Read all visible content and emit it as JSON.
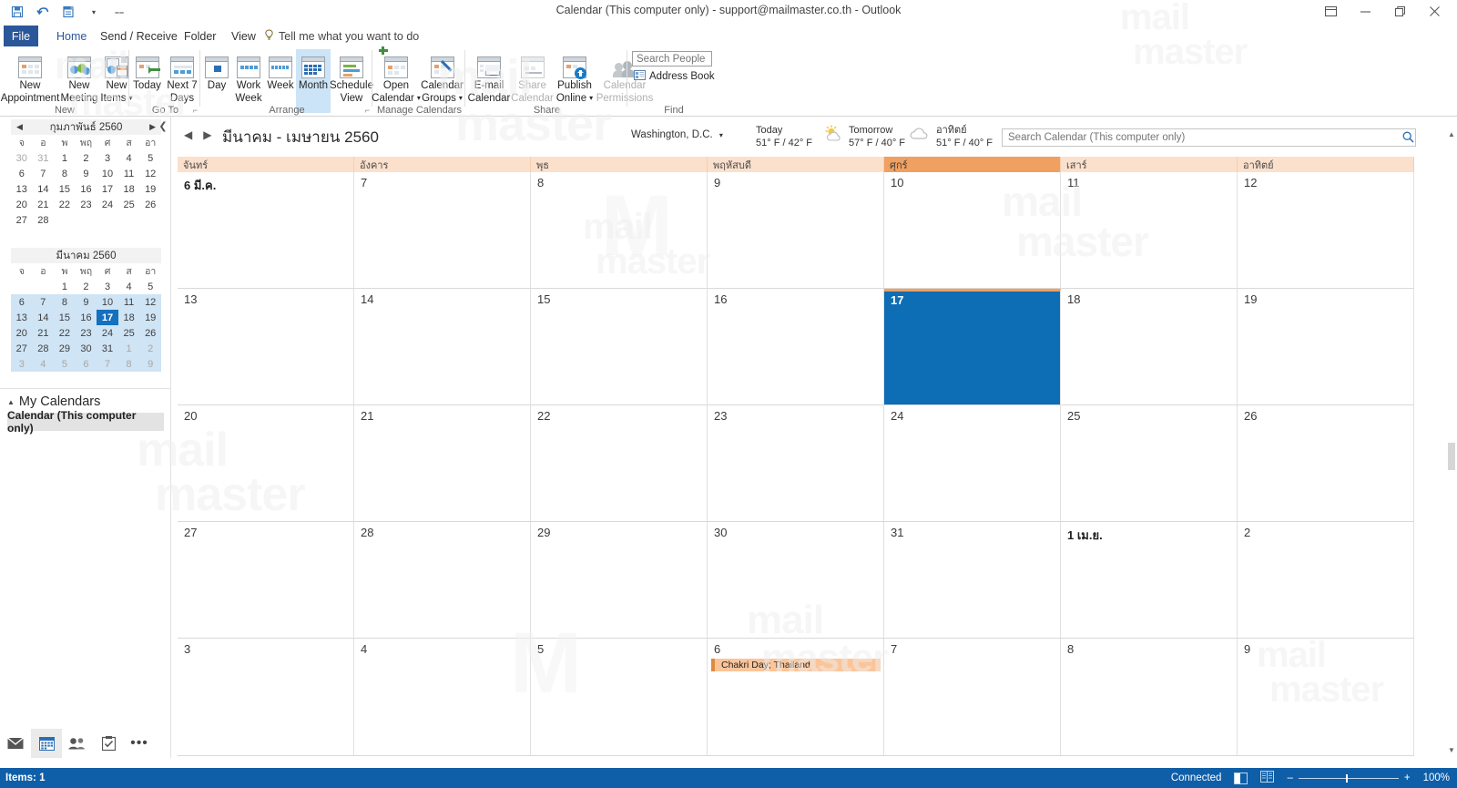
{
  "window": {
    "title": "Calendar (This computer only) - support@mailmaster.co.th  -  Outlook",
    "quick_access": [
      "save-icon",
      "undo-icon",
      "print-icon",
      "dropdown-icon",
      "customize-icon"
    ],
    "controls": [
      "ribbon-display-options-icon",
      "minimize-icon",
      "restore-icon",
      "close-icon"
    ]
  },
  "tabs": [
    {
      "label": "File",
      "name": "tab-file"
    },
    {
      "label": "Home",
      "name": "tab-home"
    },
    {
      "label": "Send / Receive",
      "name": "tab-send-receive"
    },
    {
      "label": "Folder",
      "name": "tab-folder"
    },
    {
      "label": "View",
      "name": "tab-view"
    }
  ],
  "tellme": "Tell me what you want to do",
  "ribbon": {
    "groups": [
      {
        "title": "New"
      },
      {
        "title": "Go To"
      },
      {
        "title": "Arrange"
      },
      {
        "title": "Manage Calendars"
      },
      {
        "title": "Share"
      },
      {
        "title": "Find"
      }
    ],
    "new_appointment": "New\nAppointment",
    "new_appointment_l1": "New",
    "new_appointment_l2": "Appointment",
    "new_meeting_l1": "New",
    "new_meeting_l2": "Meeting",
    "new_items_l1": "New",
    "new_items_l2": "Items",
    "today": "Today",
    "next7_l1": "Next 7",
    "next7_l2": "Days",
    "day": "Day",
    "work_week_l1": "Work",
    "work_week_l2": "Week",
    "week": "Week",
    "month": "Month",
    "schedule_l1": "Schedule",
    "schedule_l2": "View",
    "open_calendar_l1": "Open",
    "open_calendar_l2": "Calendar",
    "calendar_groups_l1": "Calendar",
    "calendar_groups_l2": "Groups",
    "email_calendar_l1": "E-mail",
    "email_calendar_l2": "Calendar",
    "share_calendar_l1": "Share",
    "share_calendar_l2": "Calendar",
    "publish_online_l1": "Publish",
    "publish_online_l2": "Online",
    "calendar_permissions_l1": "Calendar",
    "calendar_permissions_l2": "Permissions",
    "search_people_placeholder": "Search People",
    "address_book": "Address Book"
  },
  "sidebar": {
    "minicals": [
      {
        "title": "กุมภาพันธ์ 2560",
        "dow": [
          "จ",
          "อ",
          "พ",
          "พฤ",
          "ศ",
          "ส",
          "อา"
        ],
        "weeks": [
          [
            {
              "d": "30",
              "s": "dim"
            },
            {
              "d": "31",
              "s": "dim"
            },
            {
              "d": "1",
              "s": ""
            },
            {
              "d": "2",
              "s": ""
            },
            {
              "d": "3",
              "s": ""
            },
            {
              "d": "4",
              "s": ""
            },
            {
              "d": "5",
              "s": ""
            }
          ],
          [
            {
              "d": "6",
              "s": ""
            },
            {
              "d": "7",
              "s": ""
            },
            {
              "d": "8",
              "s": ""
            },
            {
              "d": "9",
              "s": ""
            },
            {
              "d": "10",
              "s": ""
            },
            {
              "d": "11",
              "s": ""
            },
            {
              "d": "12",
              "s": ""
            }
          ],
          [
            {
              "d": "13",
              "s": ""
            },
            {
              "d": "14",
              "s": ""
            },
            {
              "d": "15",
              "s": ""
            },
            {
              "d": "16",
              "s": ""
            },
            {
              "d": "17",
              "s": ""
            },
            {
              "d": "18",
              "s": ""
            },
            {
              "d": "19",
              "s": ""
            }
          ],
          [
            {
              "d": "20",
              "s": ""
            },
            {
              "d": "21",
              "s": ""
            },
            {
              "d": "22",
              "s": ""
            },
            {
              "d": "23",
              "s": ""
            },
            {
              "d": "24",
              "s": ""
            },
            {
              "d": "25",
              "s": ""
            },
            {
              "d": "26",
              "s": ""
            }
          ],
          [
            {
              "d": "27",
              "s": ""
            },
            {
              "d": "28",
              "s": ""
            },
            {
              "d": "",
              "s": ""
            },
            {
              "d": "",
              "s": ""
            },
            {
              "d": "",
              "s": ""
            },
            {
              "d": "",
              "s": ""
            },
            {
              "d": "",
              "s": ""
            }
          ]
        ]
      },
      {
        "title": "มีนาคม 2560",
        "dow": [
          "จ",
          "อ",
          "พ",
          "พฤ",
          "ศ",
          "ส",
          "อา"
        ],
        "weeks": [
          [
            {
              "d": "",
              "s": ""
            },
            {
              "d": "",
              "s": ""
            },
            {
              "d": "1",
              "s": ""
            },
            {
              "d": "2",
              "s": ""
            },
            {
              "d": "3",
              "s": ""
            },
            {
              "d": "4",
              "s": ""
            },
            {
              "d": "5",
              "s": ""
            }
          ],
          [
            {
              "d": "6",
              "s": "rng"
            },
            {
              "d": "7",
              "s": "rng"
            },
            {
              "d": "8",
              "s": "rng"
            },
            {
              "d": "9",
              "s": "rng"
            },
            {
              "d": "10",
              "s": "rng"
            },
            {
              "d": "11",
              "s": "rng"
            },
            {
              "d": "12",
              "s": "rng"
            }
          ],
          [
            {
              "d": "13",
              "s": "rng"
            },
            {
              "d": "14",
              "s": "rng"
            },
            {
              "d": "15",
              "s": "rng"
            },
            {
              "d": "16",
              "s": "rng"
            },
            {
              "d": "17",
              "s": "today"
            },
            {
              "d": "18",
              "s": "rng"
            },
            {
              "d": "19",
              "s": "rng"
            }
          ],
          [
            {
              "d": "20",
              "s": "rng"
            },
            {
              "d": "21",
              "s": "rng"
            },
            {
              "d": "22",
              "s": "rng"
            },
            {
              "d": "23",
              "s": "rng"
            },
            {
              "d": "24",
              "s": "rng"
            },
            {
              "d": "25",
              "s": "rng"
            },
            {
              "d": "26",
              "s": "rng"
            }
          ],
          [
            {
              "d": "27",
              "s": "rng"
            },
            {
              "d": "28",
              "s": "rng"
            },
            {
              "d": "29",
              "s": "rng"
            },
            {
              "d": "30",
              "s": "rng"
            },
            {
              "d": "31",
              "s": "rng"
            },
            {
              "d": "1",
              "s": "rng dim"
            },
            {
              "d": "2",
              "s": "rng dim"
            }
          ],
          [
            {
              "d": "3",
              "s": "rng dim"
            },
            {
              "d": "4",
              "s": "rng dim"
            },
            {
              "d": "5",
              "s": "rng dim"
            },
            {
              "d": "6",
              "s": "rng dim"
            },
            {
              "d": "7",
              "s": "rng dim"
            },
            {
              "d": "8",
              "s": "rng dim"
            },
            {
              "d": "9",
              "s": "rng dim"
            }
          ]
        ]
      }
    ],
    "my_calendars_label": "My Calendars",
    "calendar_item": "Calendar (This computer only)",
    "nav_icons": [
      "mail-icon",
      "calendar-icon",
      "people-icon",
      "tasks-icon",
      "more-icon"
    ]
  },
  "calendar_header": {
    "title": "มีนาคม - เมษายน 2560",
    "weather_location": "Washington,  D.C.",
    "weather": [
      {
        "day": "Today",
        "temp": "51° F / 42° F",
        "icon": "moon-icon"
      },
      {
        "day": "Tomorrow",
        "temp": "57° F / 40° F",
        "icon": "sun-cloud-icon"
      },
      {
        "day": "อาทิตย์",
        "temp": "51° F / 40° F",
        "icon": "cloud-icon"
      }
    ],
    "search_placeholder": "Search Calendar (This computer only)"
  },
  "grid": {
    "day_headers": [
      {
        "label": "จันทร์",
        "highlight": false
      },
      {
        "label": "อังคาร",
        "highlight": false
      },
      {
        "label": "พุธ",
        "highlight": false
      },
      {
        "label": "พฤหัสบดี",
        "highlight": false
      },
      {
        "label": "ศุกร์",
        "highlight": true
      },
      {
        "label": "เสาร์",
        "highlight": false
      },
      {
        "label": "อาทิตย์",
        "highlight": false
      }
    ],
    "weeks": [
      [
        {
          "num": "6 มี.ค.",
          "mono": true
        },
        {
          "num": "7"
        },
        {
          "num": "8"
        },
        {
          "num": "9"
        },
        {
          "num": "10"
        },
        {
          "num": "11"
        },
        {
          "num": "12"
        }
      ],
      [
        {
          "num": "13"
        },
        {
          "num": "14"
        },
        {
          "num": "15"
        },
        {
          "num": "16"
        },
        {
          "num": "17",
          "selected": true
        },
        {
          "num": "18"
        },
        {
          "num": "19"
        }
      ],
      [
        {
          "num": "20"
        },
        {
          "num": "21"
        },
        {
          "num": "22"
        },
        {
          "num": "23"
        },
        {
          "num": "24"
        },
        {
          "num": "25"
        },
        {
          "num": "26"
        }
      ],
      [
        {
          "num": "27"
        },
        {
          "num": "28"
        },
        {
          "num": "29"
        },
        {
          "num": "30"
        },
        {
          "num": "31"
        },
        {
          "num": "1 เม.ย.",
          "mono": true
        },
        {
          "num": "2"
        }
      ],
      [
        {
          "num": "3"
        },
        {
          "num": "4"
        },
        {
          "num": "5"
        },
        {
          "num": "6",
          "event": "Chakri Day; Thailand"
        },
        {
          "num": "7"
        },
        {
          "num": "8"
        },
        {
          "num": "9"
        }
      ]
    ]
  },
  "status": {
    "items": "Items: 1",
    "connected": "Connected",
    "zoom": "100%"
  },
  "colors": {
    "accent_blue": "#0d6db5",
    "ribbon_blue": "#2a579a",
    "header_peach": "#fbe0cc",
    "header_highlight": "#f0a060",
    "event_fill": "#fbc59a",
    "event_bar": "#e08a3c",
    "status_blue": "#0f5ea8"
  },
  "watermark": "mail master"
}
